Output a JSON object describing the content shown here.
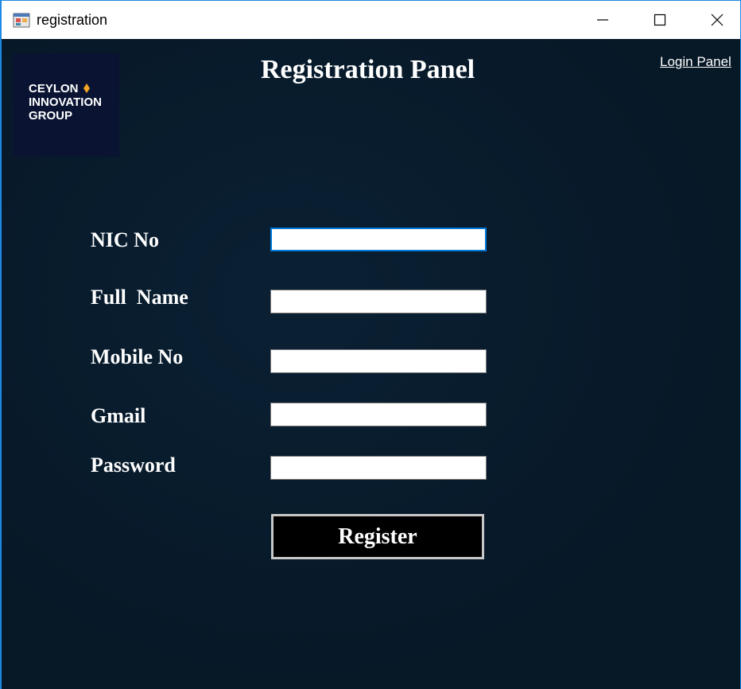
{
  "window": {
    "title": "registration",
    "icons": {
      "app": "app-form-icon",
      "minimize": "minimize-icon",
      "maximize": "maximize-icon",
      "close": "close-icon"
    }
  },
  "logo": {
    "line1": "CEYLON",
    "line2": "INNOVATION",
    "line3": "GROUP",
    "accent_color": "#f5a623",
    "background": "#0a1432"
  },
  "header": {
    "title": "Registration Panel",
    "login_link": "Login Panel"
  },
  "form": {
    "fields": [
      {
        "label": "NIC No",
        "value": "",
        "placeholder": ""
      },
      {
        "label": "Full  Name",
        "value": "",
        "placeholder": ""
      },
      {
        "label": "Mobile No",
        "value": "",
        "placeholder": ""
      },
      {
        "label": "Gmail",
        "value": "",
        "placeholder": ""
      },
      {
        "label": "Password",
        "value": "",
        "placeholder": ""
      }
    ],
    "submit_label": "Register"
  },
  "colors": {
    "background": "#071a2b",
    "focus_border": "#0078d7",
    "button_bg": "#000000"
  }
}
